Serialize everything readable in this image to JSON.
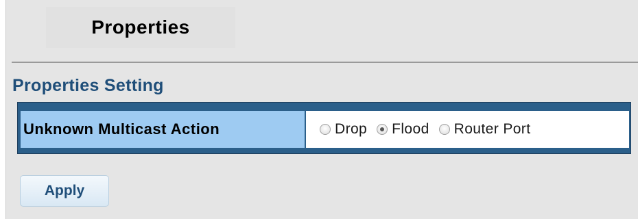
{
  "page": {
    "tab_title": "Properties"
  },
  "section": {
    "title": "Properties Setting"
  },
  "setting": {
    "label": "Unknown Multicast Action",
    "options": [
      {
        "label": "Drop",
        "checked": false
      },
      {
        "label": "Flood",
        "checked": true
      },
      {
        "label": "Router Port",
        "checked": false
      }
    ]
  },
  "actions": {
    "apply_label": "Apply"
  },
  "colors": {
    "label_bg": "#9ecbf2",
    "table_border": "#2b5f8a",
    "section_title": "#1f4e79"
  }
}
